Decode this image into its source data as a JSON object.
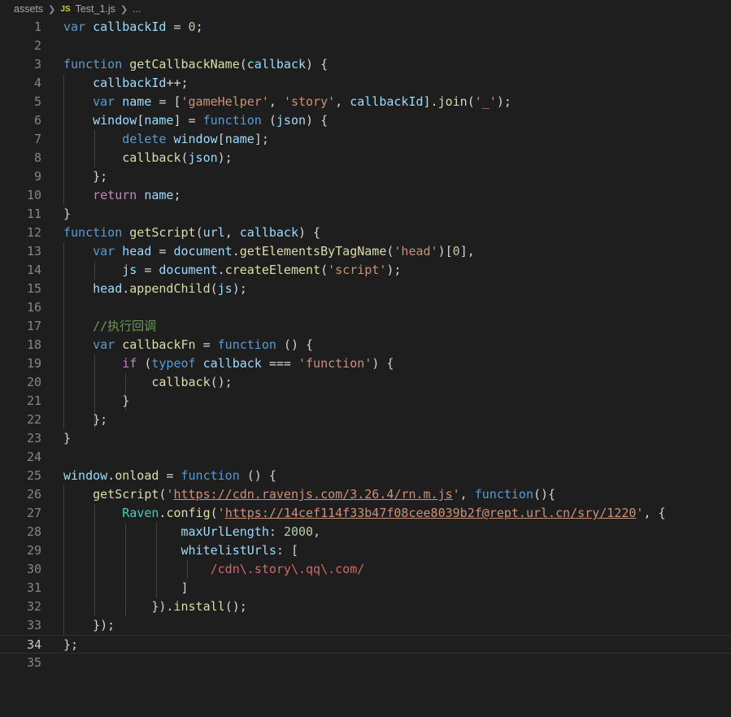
{
  "breadcrumb": {
    "folder": "assets",
    "file_badge": "JS",
    "file": "Test_1.js",
    "more": "..."
  },
  "editor": {
    "active_line": 34,
    "line_numbers": [
      "1",
      "2",
      "3",
      "4",
      "5",
      "6",
      "7",
      "8",
      "9",
      "10",
      "11",
      "12",
      "13",
      "14",
      "15",
      "16",
      "17",
      "18",
      "19",
      "20",
      "21",
      "22",
      "23",
      "24",
      "25",
      "26",
      "27",
      "28",
      "29",
      "30",
      "31",
      "32",
      "33",
      "34",
      "35"
    ]
  }
}
